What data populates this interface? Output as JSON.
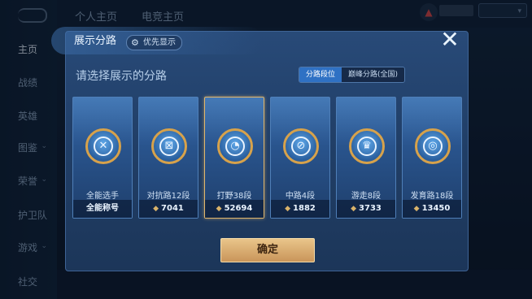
{
  "nav": {
    "items": [
      {
        "label": "主页",
        "active": true
      },
      {
        "label": "战绩",
        "active": false
      },
      {
        "label": "英雄",
        "active": false
      },
      {
        "label": "图鉴",
        "active": false
      },
      {
        "label": "荣誉",
        "active": false
      },
      {
        "label": "护卫队",
        "active": false
      },
      {
        "label": "游戏",
        "active": false
      },
      {
        "label": "社交",
        "active": false
      }
    ]
  },
  "tabs": [
    "个人主页",
    "电竞主页"
  ],
  "dialog": {
    "title": "展示分路",
    "priority_label": "优先显示",
    "prompt": "请选择展示的分路",
    "segments": [
      {
        "label": "分路段位",
        "active": true
      },
      {
        "label": "巅峰分路(全国)",
        "active": false
      }
    ],
    "cards": [
      {
        "label": "全能选手",
        "value": "全能称号",
        "glyph": "✕",
        "has_icon": false,
        "selected": false
      },
      {
        "label": "对抗路12段",
        "value": "7041",
        "glyph": "⊠",
        "has_icon": true,
        "selected": false
      },
      {
        "label": "打野38段",
        "value": "52694",
        "glyph": "◔",
        "has_icon": true,
        "selected": true
      },
      {
        "label": "中路4段",
        "value": "1882",
        "glyph": "⊘",
        "has_icon": true,
        "selected": false
      },
      {
        "label": "游走8段",
        "value": "3733",
        "glyph": "♛",
        "has_icon": true,
        "selected": false
      },
      {
        "label": "发育路18段",
        "value": "13450",
        "glyph": "◎",
        "has_icon": true,
        "selected": false
      }
    ],
    "confirm_label": "确定"
  },
  "colors": {
    "accent_gold": "#d7a24b",
    "segment_active": "#2f71c4",
    "dialog_bg": "#284a78"
  }
}
